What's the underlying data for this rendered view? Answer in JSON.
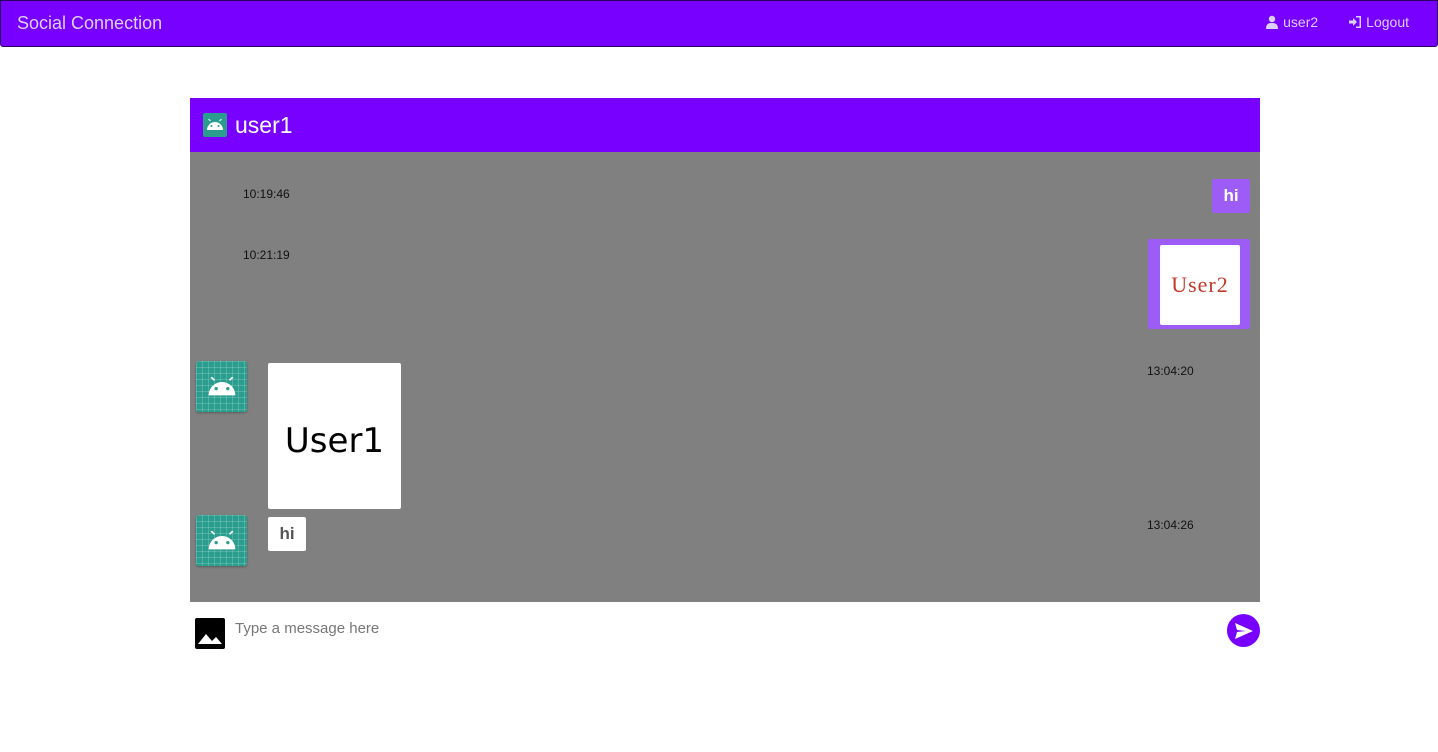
{
  "app": {
    "brand": "Social Connection"
  },
  "nav": {
    "user_label": "user2",
    "logout_label": "Logout"
  },
  "chat": {
    "contact_name": "user1"
  },
  "messages": [
    {
      "time": "10:19:46",
      "text": "hi",
      "direction": "out"
    },
    {
      "time": "10:21:19",
      "image_text": "User2",
      "direction": "out"
    },
    {
      "time": "13:04:20",
      "image_text": "User1",
      "direction": "in"
    },
    {
      "time": "13:04:26",
      "text": "hi",
      "direction": "in"
    }
  ],
  "composer": {
    "placeholder": "Type a message here"
  },
  "colors": {
    "primary": "#7700ff",
    "outgoing_bubble": "#9d5cf6",
    "chat_background": "#808080",
    "avatar": "#2a9d8f"
  }
}
